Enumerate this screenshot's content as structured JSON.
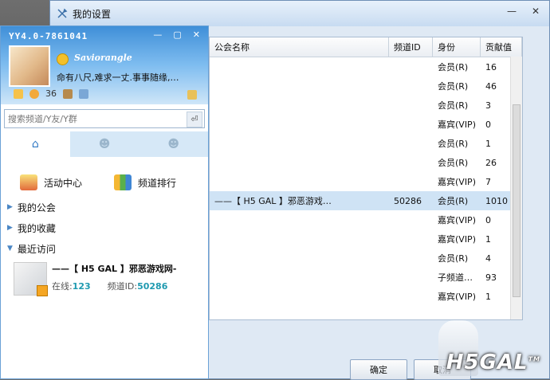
{
  "settings_window": {
    "title": "我的设置",
    "controls": {
      "minimize": "—",
      "close": "✕"
    },
    "table": {
      "headers": {
        "name": "公会名称",
        "id": "频道ID",
        "role": "身份",
        "value": "贡献值"
      },
      "rows": [
        {
          "name": "",
          "id": "",
          "role": "会员(R)",
          "value": "16"
        },
        {
          "name": "",
          "id": "",
          "role": "会员(R)",
          "value": "46"
        },
        {
          "name": "",
          "id": "",
          "role": "会员(R)",
          "value": "3"
        },
        {
          "name": "",
          "id": "",
          "role": "嘉宾(VIP)",
          "value": "0"
        },
        {
          "name": "",
          "id": "",
          "role": "会员(R)",
          "value": "1"
        },
        {
          "name": "",
          "id": "",
          "role": "会员(R)",
          "value": "26"
        },
        {
          "name": "",
          "id": "",
          "role": "嘉宾(VIP)",
          "value": "7"
        },
        {
          "name": "——【 H5 GAL 】邪恶游戏…",
          "id": "50286",
          "role": "会员(R)",
          "value": "1010"
        },
        {
          "name": "",
          "id": "",
          "role": "嘉宾(VIP)",
          "value": "0"
        },
        {
          "name": "",
          "id": "",
          "role": "嘉宾(VIP)",
          "value": "1"
        },
        {
          "name": "",
          "id": "",
          "role": "会员(R)",
          "value": "4"
        },
        {
          "name": "",
          "id": "",
          "role": "子频道…",
          "value": "93"
        },
        {
          "name": "",
          "id": "",
          "role": "嘉宾(VIP)",
          "value": "1"
        }
      ]
    },
    "ok_label": "确定",
    "cancel_label": "取消"
  },
  "yy_panel": {
    "title": "YY4.0-7861041",
    "controls": {
      "min": "—",
      "max": "▢",
      "close": "✕"
    },
    "nickname": "Saviorangle",
    "signature": "命有八尺,难求一丈.事事随缘,…",
    "level": "36",
    "search_placeholder": "搜索频道/Y友/Y群",
    "search_go": "⏎",
    "tabs": [
      {
        "icon": "home-icon",
        "glyph": "⌂"
      },
      {
        "icon": "contact-icon",
        "glyph": "☻"
      },
      {
        "icon": "group-icon",
        "glyph": "☻"
      }
    ],
    "quick": {
      "activity": "活动中心",
      "ranking": "频道排行"
    },
    "tree": {
      "guild": "我的公会",
      "favorites": "我的收藏",
      "recent": "最近访问"
    },
    "recent_item": {
      "title": "——【 H5 GAL 】邪恶游戏网-",
      "online_label": "在线:",
      "online_value": "123",
      "channel_label": "频道ID:",
      "channel_value": "50286"
    }
  },
  "watermark": "H5GAL",
  "watermark_tm": "TM",
  "colors": {
    "accent": "#3f8fd8",
    "selected_row": "#cfe3f5",
    "online": "#1f9ab0"
  }
}
